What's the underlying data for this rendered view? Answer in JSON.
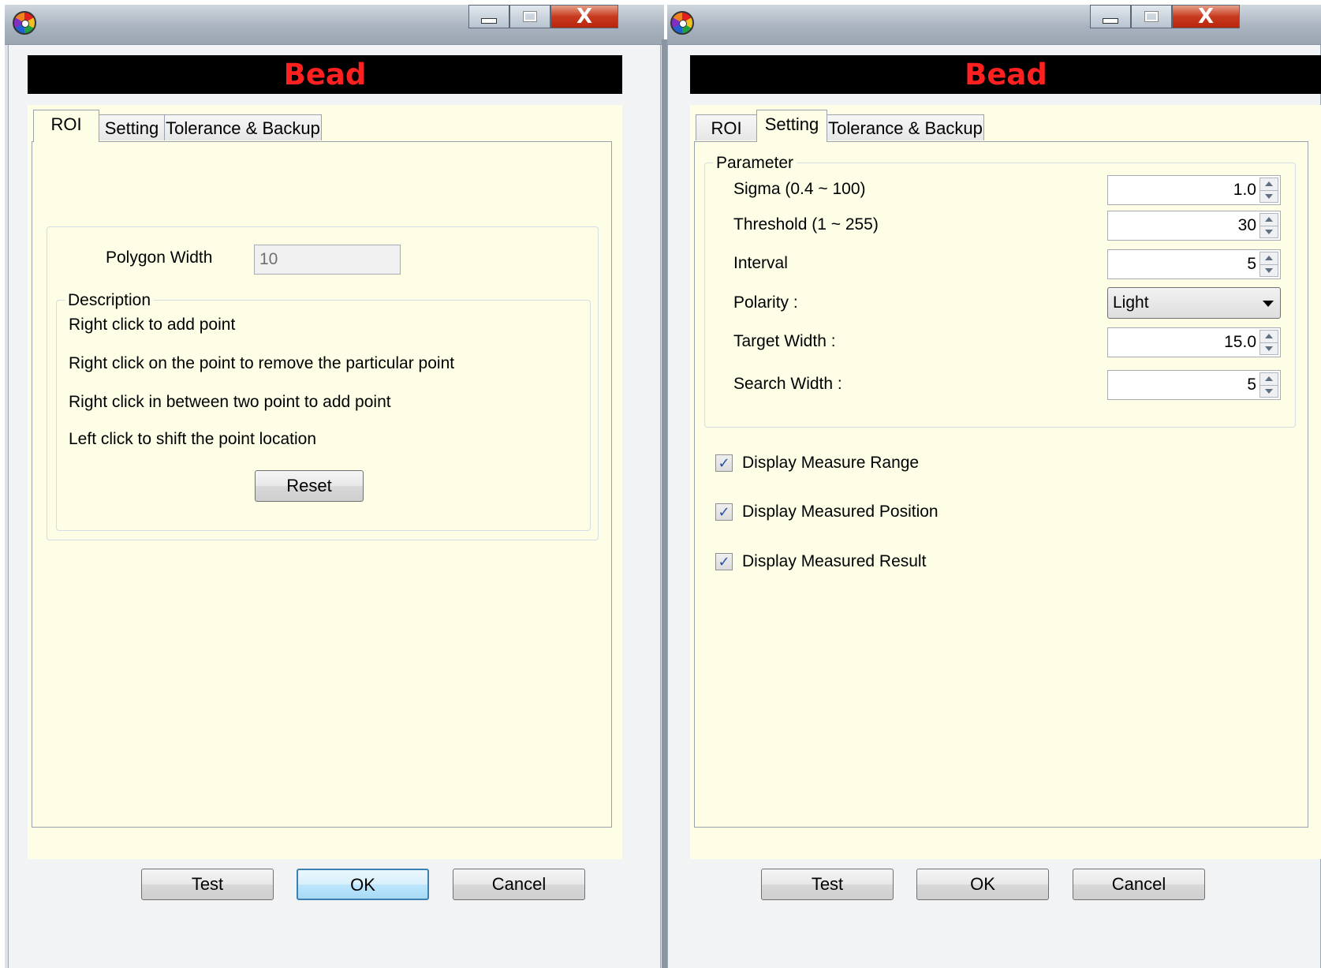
{
  "left_window": {
    "banner_title": "Bead",
    "caption_close": "X",
    "tabs": [
      "ROI",
      "Setting",
      "Tolerance & Backup"
    ],
    "active_tab": "ROI",
    "roi": {
      "polygon_width_label": "Polygon Width",
      "polygon_width_value": "10",
      "description_legend": "Description",
      "description_lines": [
        "Right click to add point",
        "Right click on the point to remove the particular point",
        "Right click in between two point to add point",
        "Left click to shift the point location"
      ],
      "reset_label": "Reset"
    },
    "buttons": {
      "test": "Test",
      "ok": "OK",
      "cancel": "Cancel"
    }
  },
  "right_window": {
    "banner_title": "Bead",
    "caption_close": "X",
    "tabs": [
      "ROI",
      "Setting",
      "Tolerance & Backup"
    ],
    "active_tab": "Setting",
    "setting": {
      "parameter_legend": "Parameter",
      "sigma_label": "Sigma (0.4 ~ 100)",
      "sigma_value": "1.0",
      "threshold_label": "Threshold (1 ~ 255)",
      "threshold_value": "30",
      "interval_label": "Interval",
      "interval_value": "5",
      "polarity_label": "Polarity :",
      "polarity_value": "Light",
      "target_width_label": "Target Width :",
      "target_width_value": "15.0",
      "search_width_label": "Search Width :",
      "search_width_value": "5",
      "checkboxes": [
        {
          "label": "Display Measure Range",
          "checked": true
        },
        {
          "label": "Display Measured Position",
          "checked": true
        },
        {
          "label": "Display Measured Result",
          "checked": true
        }
      ]
    },
    "buttons": {
      "test": "Test",
      "ok": "OK",
      "cancel": "Cancel"
    }
  },
  "colors": {
    "banner_bg": "#000000",
    "banner_text": "#ff2020",
    "panel_bg": "#fefee6",
    "close_button": "#c83a1e"
  }
}
